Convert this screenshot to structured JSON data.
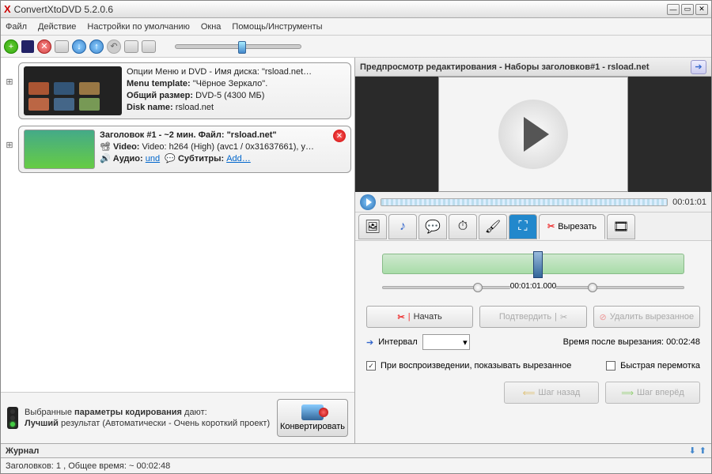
{
  "window": {
    "title": "ConvertXtoDVD 5.2.0.6"
  },
  "menu": {
    "file": "Файл",
    "action": "Действие",
    "defaults": "Настройки по умолчанию",
    "windows": "Окна",
    "help": "Помощь/Инструменты"
  },
  "tree": {
    "dvd": {
      "line1": "Опции Меню и DVD - Имя диска: \"rsload.net…",
      "tmpl_k": "Menu template:",
      "tmpl_v": "\"Чёрное Зеркало\".",
      "size_k": "Общий размер:",
      "size_v": "DVD-5 (4300 МБ)",
      "disk_k": "Disk name:",
      "disk_v": "rsload.net"
    },
    "title1": {
      "hdr": "Заголовок #1 - ~2 мин. Файл: \"rsload.net\"",
      "video_k": "Video:",
      "video_v": "Video: h264 (High) (avc1 / 0x31637661), y…",
      "audio_k": "Аудио:",
      "audio_v": "und",
      "sub_k": "Субтитры:",
      "sub_v": "Add…"
    }
  },
  "encode": {
    "line1a": "Выбранные ",
    "line1b": "параметры кодирования",
    "line1c": " дают:",
    "line2a": "Лучший",
    "line2b": " результат (Автоматически - Очень короткий проект)"
  },
  "convert": "Конвертировать",
  "preview": {
    "header": "Предпросмотр редактирования - Наборы заголовков#1 - rsload.net",
    "time": "00:01:01"
  },
  "tabs": {
    "cut": "Вырезать"
  },
  "cut": {
    "pos": "00:01:01.000",
    "start": "Начать",
    "confirm": "Подтвердить",
    "delete": "Удалить вырезанное",
    "interval": "Интервал",
    "after_k": "Время после вырезания:",
    "after_v": "00:02:48",
    "showcut": "При воспроизведении, показывать вырезанное",
    "fast": "Быстрая перемотка",
    "back": "Шаг назад",
    "fwd": "Шаг вперёд"
  },
  "journal": "Журнал",
  "status": "Заголовков: 1 , Общее время: ~ 00:02:48"
}
